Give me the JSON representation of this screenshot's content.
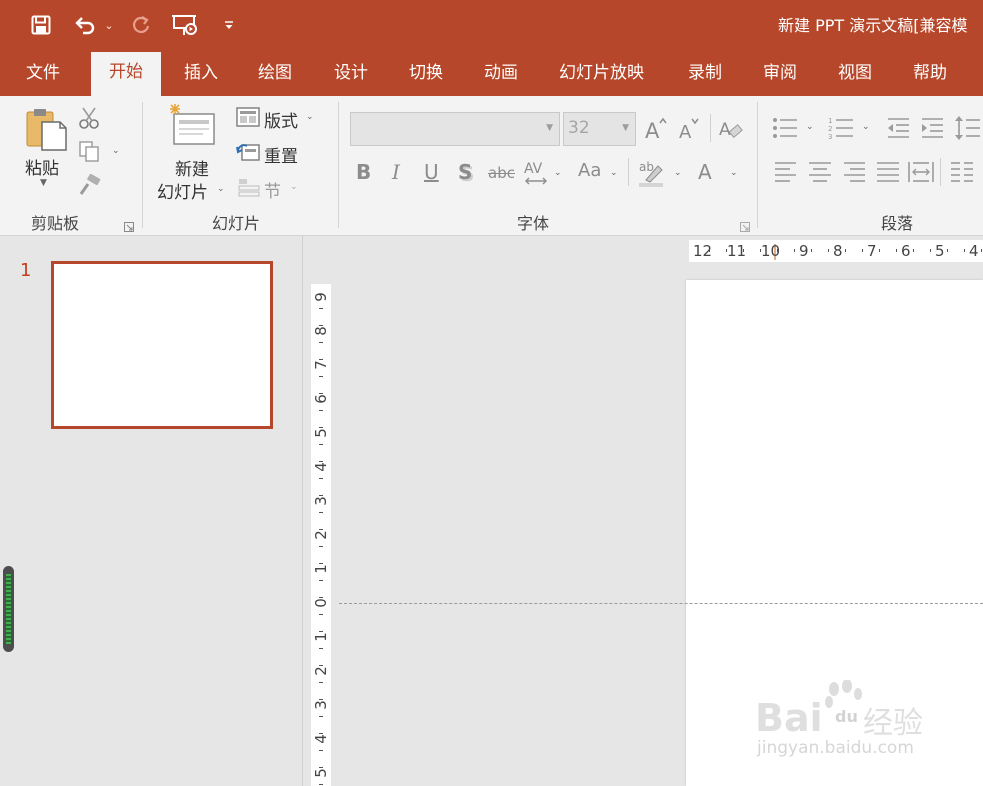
{
  "window": {
    "title": "新建 PPT 演示文稿[兼容模"
  },
  "quick_access": {
    "icons": [
      "save-icon",
      "undo-icon",
      "redo-icon",
      "presentation-icon",
      "customize-icon"
    ],
    "dropdown_glyph": "⌄"
  },
  "tabs": [
    {
      "label": "文件",
      "active": false
    },
    {
      "label": "开始",
      "active": true
    },
    {
      "label": "插入",
      "active": false
    },
    {
      "label": "绘图",
      "active": false
    },
    {
      "label": "设计",
      "active": false
    },
    {
      "label": "切换",
      "active": false
    },
    {
      "label": "动画",
      "active": false
    },
    {
      "label": "幻灯片放映",
      "active": false
    },
    {
      "label": "录制",
      "active": false
    },
    {
      "label": "审阅",
      "active": false
    },
    {
      "label": "视图",
      "active": false
    },
    {
      "label": "帮助",
      "active": false
    }
  ],
  "ribbon": {
    "clipboard": {
      "group_label": "剪贴板",
      "paste_label": "粘贴"
    },
    "slides": {
      "group_label": "幻灯片",
      "new_slide_line1": "新建",
      "new_slide_line2": "幻灯片",
      "layout_label": "版式",
      "reset_label": "重置",
      "section_label": "节"
    },
    "font": {
      "group_label": "字体",
      "font_name_value": "",
      "font_size_value": "32",
      "bold": "B",
      "italic": "I",
      "underline": "U",
      "shadow": "S",
      "strikethrough": "abc",
      "spacing": "AV",
      "change_case": "Aa",
      "font_color": "A"
    },
    "paragraph": {
      "group_label": "段落"
    }
  },
  "slide_panel": {
    "slides": [
      {
        "number": "1"
      }
    ]
  },
  "rulers": {
    "horizontal": [
      "12",
      "11",
      "10",
      "9",
      "8",
      "7",
      "6",
      "5",
      "4"
    ],
    "vertical": [
      "9",
      "8",
      "7",
      "6",
      "5",
      "4",
      "3",
      "2",
      "1",
      "0",
      "1",
      "2",
      "3",
      "4",
      "5"
    ]
  },
  "watermark": {
    "brand_left": "Bai",
    "brand_right": "经验",
    "url": "jingyan.baidu.com"
  },
  "colors": {
    "accent": "#b7472a",
    "ribbon_bg": "#f3f3f3",
    "workspace_bg": "#e6e6e6"
  }
}
